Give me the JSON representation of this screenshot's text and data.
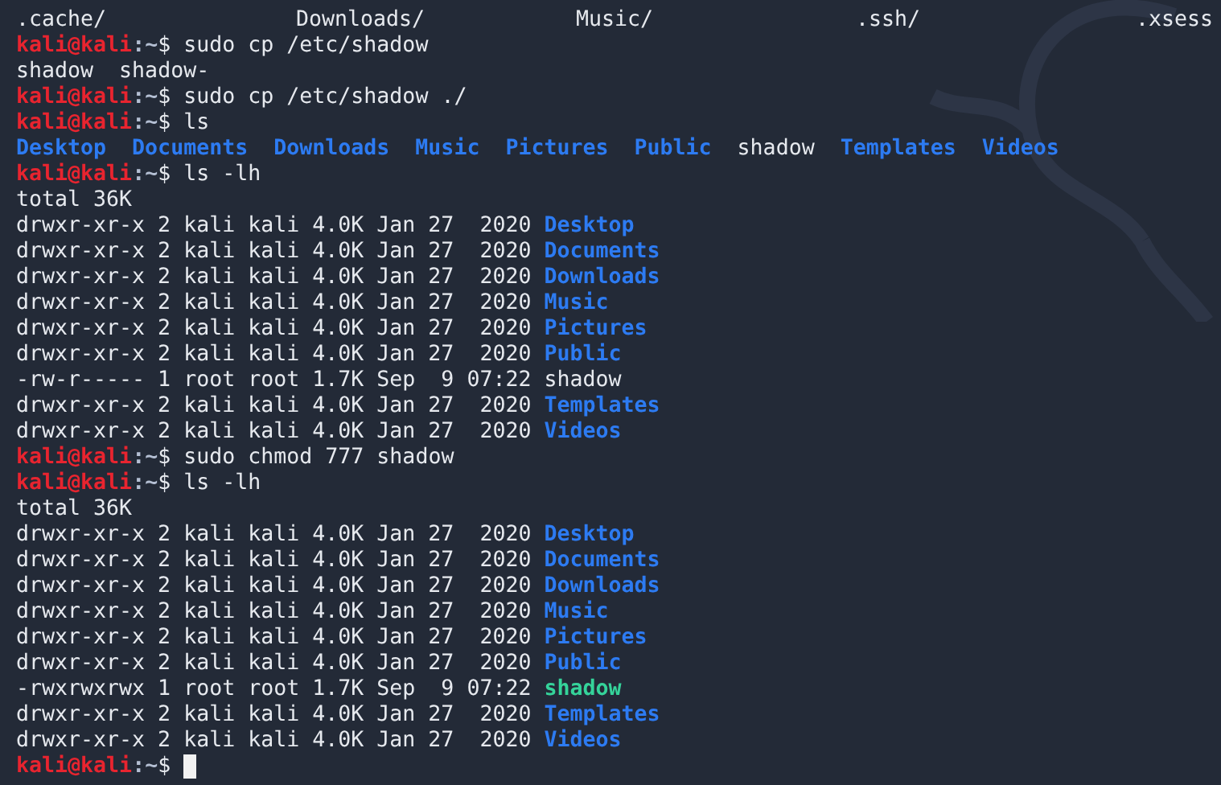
{
  "terminal": {
    "lines": [
      {
        "kind": "columns",
        "items": [
          ".cache/",
          "Downloads/",
          "Music/",
          ".ssh/",
          ".xsess"
        ]
      },
      {
        "kind": "prompt",
        "user": "kali@kali",
        "path": ":~",
        "symbol": "$",
        "command": "sudo cp /etc/shadow"
      },
      {
        "kind": "files",
        "items": [
          {
            "name": "shadow",
            "kind": "file"
          },
          {
            "name": "shadow-",
            "kind": "file"
          }
        ]
      },
      {
        "kind": "prompt",
        "user": "kali@kali",
        "path": ":~",
        "symbol": "$",
        "command": "sudo cp /etc/shadow ./"
      },
      {
        "kind": "prompt",
        "user": "kali@kali",
        "path": ":~",
        "symbol": "$",
        "command": "ls"
      },
      {
        "kind": "files",
        "items": [
          {
            "name": "Desktop",
            "kind": "dir"
          },
          {
            "name": "Documents",
            "kind": "dir"
          },
          {
            "name": "Downloads",
            "kind": "dir"
          },
          {
            "name": "Music",
            "kind": "dir"
          },
          {
            "name": "Pictures",
            "kind": "dir"
          },
          {
            "name": "Public",
            "kind": "dir"
          },
          {
            "name": "shadow",
            "kind": "file"
          },
          {
            "name": "Templates",
            "kind": "dir"
          },
          {
            "name": "Videos",
            "kind": "dir"
          }
        ]
      },
      {
        "kind": "prompt",
        "user": "kali@kali",
        "path": ":~",
        "symbol": "$",
        "command": "ls -lh"
      },
      {
        "kind": "text",
        "text": "total 36K"
      },
      {
        "kind": "listing",
        "info": "drwxr-xr-x 2 kali kali 4.0K Jan 27  2020",
        "file": {
          "name": "Desktop",
          "kind": "dir"
        }
      },
      {
        "kind": "listing",
        "info": "drwxr-xr-x 2 kali kali 4.0K Jan 27  2020",
        "file": {
          "name": "Documents",
          "kind": "dir"
        }
      },
      {
        "kind": "listing",
        "info": "drwxr-xr-x 2 kali kali 4.0K Jan 27  2020",
        "file": {
          "name": "Downloads",
          "kind": "dir"
        }
      },
      {
        "kind": "listing",
        "info": "drwxr-xr-x 2 kali kali 4.0K Jan 27  2020",
        "file": {
          "name": "Music",
          "kind": "dir"
        }
      },
      {
        "kind": "listing",
        "info": "drwxr-xr-x 2 kali kali 4.0K Jan 27  2020",
        "file": {
          "name": "Pictures",
          "kind": "dir"
        }
      },
      {
        "kind": "listing",
        "info": "drwxr-xr-x 2 kali kali 4.0K Jan 27  2020",
        "file": {
          "name": "Public",
          "kind": "dir"
        }
      },
      {
        "kind": "listing",
        "info": "-rw-r----- 1 root root 1.7K Sep  9 07:22",
        "file": {
          "name": "shadow",
          "kind": "file"
        }
      },
      {
        "kind": "listing",
        "info": "drwxr-xr-x 2 kali kali 4.0K Jan 27  2020",
        "file": {
          "name": "Templates",
          "kind": "dir"
        }
      },
      {
        "kind": "listing",
        "info": "drwxr-xr-x 2 kali kali 4.0K Jan 27  2020",
        "file": {
          "name": "Videos",
          "kind": "dir"
        }
      },
      {
        "kind": "prompt",
        "user": "kali@kali",
        "path": ":~",
        "symbol": "$",
        "command": "sudo chmod 777 shadow"
      },
      {
        "kind": "prompt",
        "user": "kali@kali",
        "path": ":~",
        "symbol": "$",
        "command": "ls -lh"
      },
      {
        "kind": "text",
        "text": "total 36K"
      },
      {
        "kind": "listing",
        "info": "drwxr-xr-x 2 kali kali 4.0K Jan 27  2020",
        "file": {
          "name": "Desktop",
          "kind": "dir"
        }
      },
      {
        "kind": "listing",
        "info": "drwxr-xr-x 2 kali kali 4.0K Jan 27  2020",
        "file": {
          "name": "Documents",
          "kind": "dir"
        }
      },
      {
        "kind": "listing",
        "info": "drwxr-xr-x 2 kali kali 4.0K Jan 27  2020",
        "file": {
          "name": "Downloads",
          "kind": "dir"
        }
      },
      {
        "kind": "listing",
        "info": "drwxr-xr-x 2 kali kali 4.0K Jan 27  2020",
        "file": {
          "name": "Music",
          "kind": "dir"
        }
      },
      {
        "kind": "listing",
        "info": "drwxr-xr-x 2 kali kali 4.0K Jan 27  2020",
        "file": {
          "name": "Pictures",
          "kind": "dir"
        }
      },
      {
        "kind": "listing",
        "info": "drwxr-xr-x 2 kali kali 4.0K Jan 27  2020",
        "file": {
          "name": "Public",
          "kind": "dir"
        }
      },
      {
        "kind": "listing",
        "info": "-rwxrwxrwx 1 root root 1.7K Sep  9 07:22",
        "file": {
          "name": "shadow",
          "kind": "exec"
        }
      },
      {
        "kind": "listing",
        "info": "drwxr-xr-x 2 kali kali 4.0K Jan 27  2020",
        "file": {
          "name": "Templates",
          "kind": "dir"
        }
      },
      {
        "kind": "listing",
        "info": "drwxr-xr-x 2 kali kali 4.0K Jan 27  2020",
        "file": {
          "name": "Videos",
          "kind": "dir"
        }
      },
      {
        "kind": "prompt",
        "user": "kali@kali",
        "path": ":~",
        "symbol": "$",
        "cursor": true
      }
    ]
  }
}
